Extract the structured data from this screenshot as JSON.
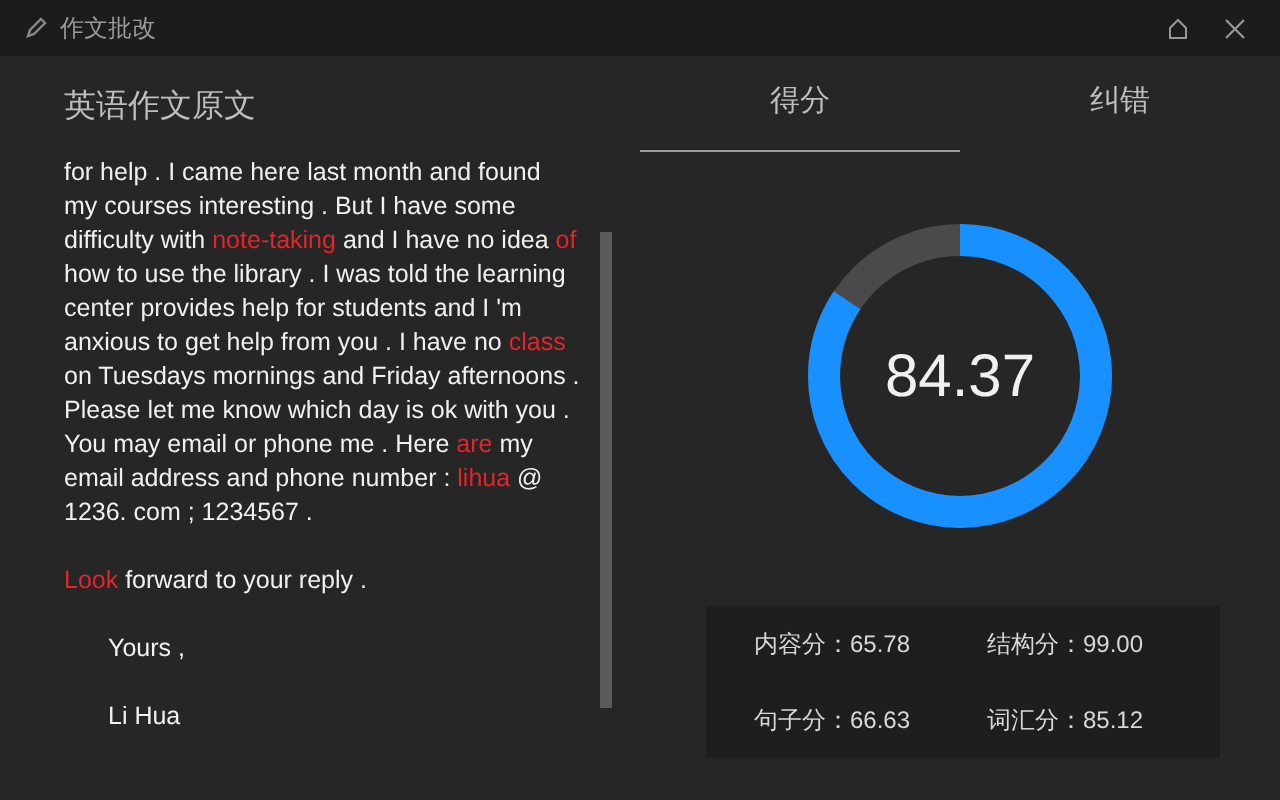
{
  "window": {
    "title": "作文批改"
  },
  "essay": {
    "heading": "英语作文原文",
    "paragraphs": [
      {
        "kind": "body",
        "segments": [
          {
            "text": "for help . I came here last month and found my courses interesting . But I have some difficulty with ",
            "error": false
          },
          {
            "text": "note-taking",
            "error": true
          },
          {
            "text": " and I have no idea ",
            "error": false
          },
          {
            "text": "of",
            "error": true
          },
          {
            "text": " how to use the library . I was told the learning center provides help for students and I 'm anxious to get help from you . I have no ",
            "error": false
          },
          {
            "text": "class",
            "error": true
          },
          {
            "text": " on Tuesdays mornings and Friday afternoons . Please let me know which day is ok with you . You may email or phone me . Here ",
            "error": false
          },
          {
            "text": "are",
            "error": true
          },
          {
            "text": " my email address and phone number : ",
            "error": false
          },
          {
            "text": "lihua",
            "error": true
          },
          {
            "text": " @ 1236. com ; 1234567 .",
            "error": false
          }
        ]
      },
      {
        "kind": "body",
        "segments": [
          {
            "text": "Look",
            "error": true
          },
          {
            "text": " forward to your reply .",
            "error": false
          }
        ]
      },
      {
        "kind": "closing",
        "segments": [
          {
            "text": "Yours ,",
            "error": false
          }
        ]
      },
      {
        "kind": "closing",
        "segments": [
          {
            "text": "Li Hua",
            "error": false
          }
        ]
      }
    ]
  },
  "tabs": [
    {
      "label": "得分",
      "selected": true
    },
    {
      "label": "纠错",
      "selected": false
    }
  ],
  "score": {
    "value": "84.37",
    "level": 0.8437
  },
  "subscores": [
    {
      "label": "内容分：",
      "value": "65.78"
    },
    {
      "label": "结构分：",
      "value": "99.00"
    },
    {
      "label": "句子分：",
      "value": "66.63"
    },
    {
      "label": "词汇分：",
      "value": "85.12"
    }
  ]
}
